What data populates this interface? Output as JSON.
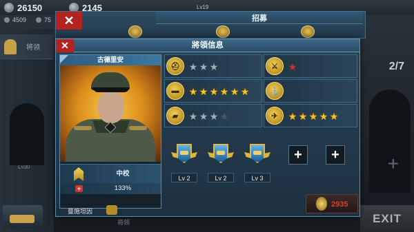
{
  "top_bar": {
    "gold": "26150",
    "silver": "2145",
    "sub_resource_1": "4509",
    "sub_resource_2": "75",
    "level": "Lv19"
  },
  "sidebar": {
    "tab_label": "将领",
    "lock_label": "Lv30"
  },
  "recruit_panel": {
    "title": "招募"
  },
  "dialog": {
    "title": "將領信息",
    "general_name": "古德里安",
    "rank": "中校",
    "health_percent": "133%"
  },
  "stats": {
    "tank_infantry": {
      "icon": "helmet-icon",
      "stars": [
        1,
        0,
        0
      ],
      "filled_gold": 0,
      "filled_grey": 3
    },
    "tank_armor": {
      "icon": "tank-icon",
      "filled_gold": 6
    },
    "tank_artillery": {
      "icon": "artillery-icon",
      "filled_grey": 3,
      "dark": 1
    },
    "rocket": {
      "icon": "cannon-icon",
      "filled_red": 1
    },
    "navy": {
      "icon": "anchor-icon",
      "filled_gold": 0
    },
    "air": {
      "icon": "plane-icon",
      "filled_gold": 5
    }
  },
  "medals": [
    {
      "label": "Lv 2"
    },
    {
      "label": "Lv 2"
    },
    {
      "label": "Lv 3"
    }
  ],
  "add_slot_symbol": "+",
  "right_panel": {
    "counter": "2/7",
    "exit_label": "EXIT"
  },
  "bottom": {
    "commander_name": "曼施坦因",
    "tab_label": "将领",
    "exp_value": "2935"
  },
  "colors": {
    "close_red": "#b4231f",
    "star_gold": "#f4c329",
    "star_red": "#d42a24",
    "panel_blue": "#2a4558",
    "exp_red": "#e03b32"
  }
}
